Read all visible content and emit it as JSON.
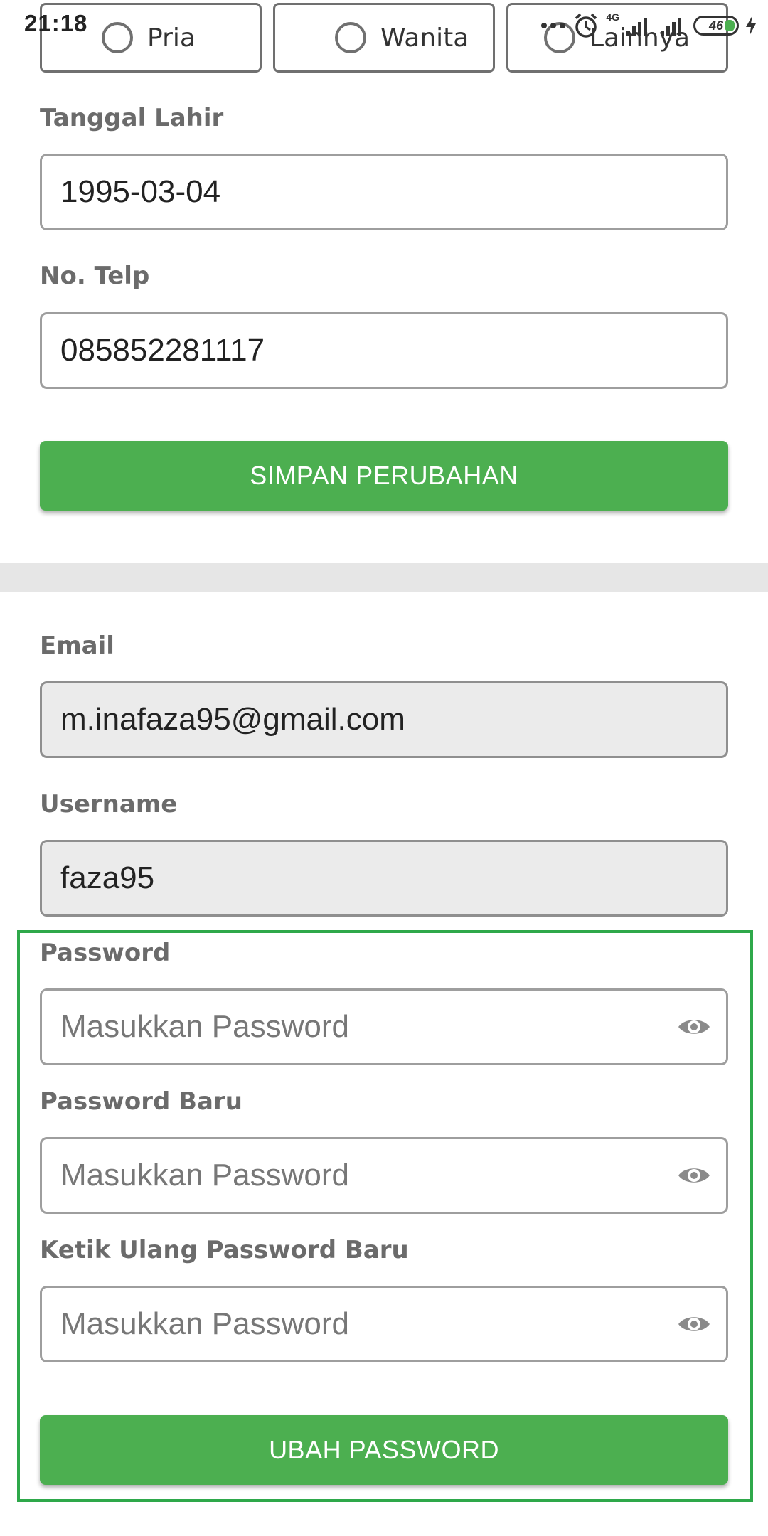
{
  "status_bar": {
    "time": "21:18",
    "network": "4G",
    "battery": "46"
  },
  "gender": {
    "options": [
      "Pria",
      "Wanita",
      "Lainnya"
    ]
  },
  "profile_form": {
    "birthdate": {
      "label": "Tanggal Lahir",
      "value": "1995-03-04"
    },
    "phone": {
      "label": "No. Telp",
      "value": "085852281117"
    },
    "save_label": "SIMPAN PERUBAHAN"
  },
  "account": {
    "email": {
      "label": "Email",
      "value": "m.inafaza95@gmail.com"
    },
    "username": {
      "label": "Username",
      "value": "faza95"
    }
  },
  "password_form": {
    "current": {
      "label": "Password",
      "placeholder": "Masukkan Password"
    },
    "new": {
      "label": "Password Baru",
      "placeholder": "Masukkan Password"
    },
    "confirm": {
      "label": "Ketik Ulang Password Baru",
      "placeholder": "Masukkan Password"
    },
    "submit_label": "UBAH PASSWORD"
  },
  "colors": {
    "primary_green": "#4caf50",
    "highlight_border": "#2ea84a",
    "disabled_field": "#ebebeb"
  }
}
